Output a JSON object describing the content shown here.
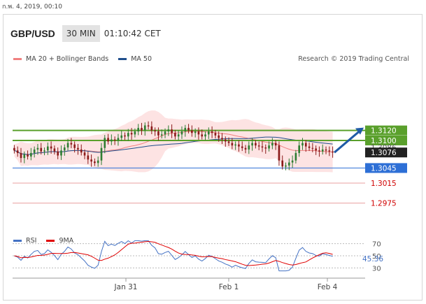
{
  "stamp": "ก.พ. 4, 2019, 00:10",
  "header": {
    "symbol": "GBP/USD",
    "timeframe": "30 MIN",
    "time": "01:10:42 CET"
  },
  "legend": {
    "ma20": {
      "label": "MA 20 + Bollinger Bands",
      "color": "#f08080"
    },
    "ma50": {
      "label": "MA 50",
      "color": "#1f4e8c"
    }
  },
  "credit": "Research © 2019 Trading Central",
  "rsi_legend": {
    "rsi": {
      "label": "RSI",
      "color": "#4472c4"
    },
    "ma9": {
      "label": "9MA",
      "color": "#e00000"
    }
  },
  "chart_data": {
    "type": "candlestick",
    "price_range": [
      1.2955,
      1.3185
    ],
    "x_labels": [
      "Jan 31",
      "Feb 1",
      "Feb 4"
    ],
    "levels": [
      {
        "value": 1.312,
        "label": "1.3120",
        "kind": "resistance",
        "line": "#5aa02c",
        "tag_bg": "#5aa02c",
        "tag_fg": "#ffffff"
      },
      {
        "value": 1.31,
        "label": "1.3100",
        "kind": "resistance",
        "line": "#5aa02c",
        "tag_bg": "#5aa02c",
        "tag_fg": "#ffffff"
      },
      {
        "value": 1.3086,
        "label": "1.3086",
        "kind": "marker",
        "tag_fg": "#555555"
      },
      {
        "value": 1.3076,
        "label": "1.3076",
        "kind": "last",
        "tag_bg": "#222222",
        "tag_fg": "#ffffff"
      },
      {
        "value": 1.3045,
        "label": "1.3045",
        "kind": "pivot",
        "line": "#2d6fd6",
        "tag_bg": "#2d6fd6",
        "tag_fg": "#ffffff"
      },
      {
        "value": 1.3015,
        "label": "1.3015",
        "kind": "support",
        "line": "#e8a0a0",
        "tag_fg": "#d00000"
      },
      {
        "value": 1.2975,
        "label": "1.2975",
        "kind": "support",
        "line": "#e8a0a0",
        "tag_fg": "#d00000"
      }
    ],
    "rsi": {
      "range": [
        20,
        80
      ],
      "levels": [
        70,
        50,
        30
      ],
      "level_labels": [
        "70",
        "50",
        "30"
      ],
      "last_value": "45.36"
    },
    "ohlc_close_series": [
      1.308,
      1.3075,
      1.3065,
      1.3072,
      1.3068,
      1.3075,
      1.3082,
      1.3085,
      1.3078,
      1.308,
      1.3088,
      1.3084,
      1.3078,
      1.307,
      1.308,
      1.3086,
      1.3095,
      1.3092,
      1.3085,
      1.3082,
      1.3076,
      1.307,
      1.3062,
      1.3058,
      1.3055,
      1.306,
      1.3085,
      1.3105,
      1.3098,
      1.3102,
      1.31,
      1.3105,
      1.311,
      1.3108,
      1.3115,
      1.3112,
      1.3118,
      1.3125,
      1.312,
      1.313,
      1.3128,
      1.312,
      1.3118,
      1.311,
      1.3112,
      1.3118,
      1.3122,
      1.3115,
      1.3108,
      1.3112,
      1.3118,
      1.3125,
      1.312,
      1.3115,
      1.3118,
      1.3112,
      1.3108,
      1.3112,
      1.3118,
      1.3115,
      1.311,
      1.3105,
      1.3102,
      1.3098,
      1.3095,
      1.309,
      1.3092,
      1.3088,
      1.3085,
      1.3082,
      1.309,
      1.3095,
      1.309,
      1.3088,
      1.3086,
      1.3084,
      1.309,
      1.3095,
      1.309,
      1.306,
      1.3048,
      1.305,
      1.3056,
      1.306,
      1.3075,
      1.309,
      1.3095,
      1.3088,
      1.3085,
      1.3084,
      1.308,
      1.3078,
      1.3082,
      1.308,
      1.3078,
      1.3076
    ]
  }
}
